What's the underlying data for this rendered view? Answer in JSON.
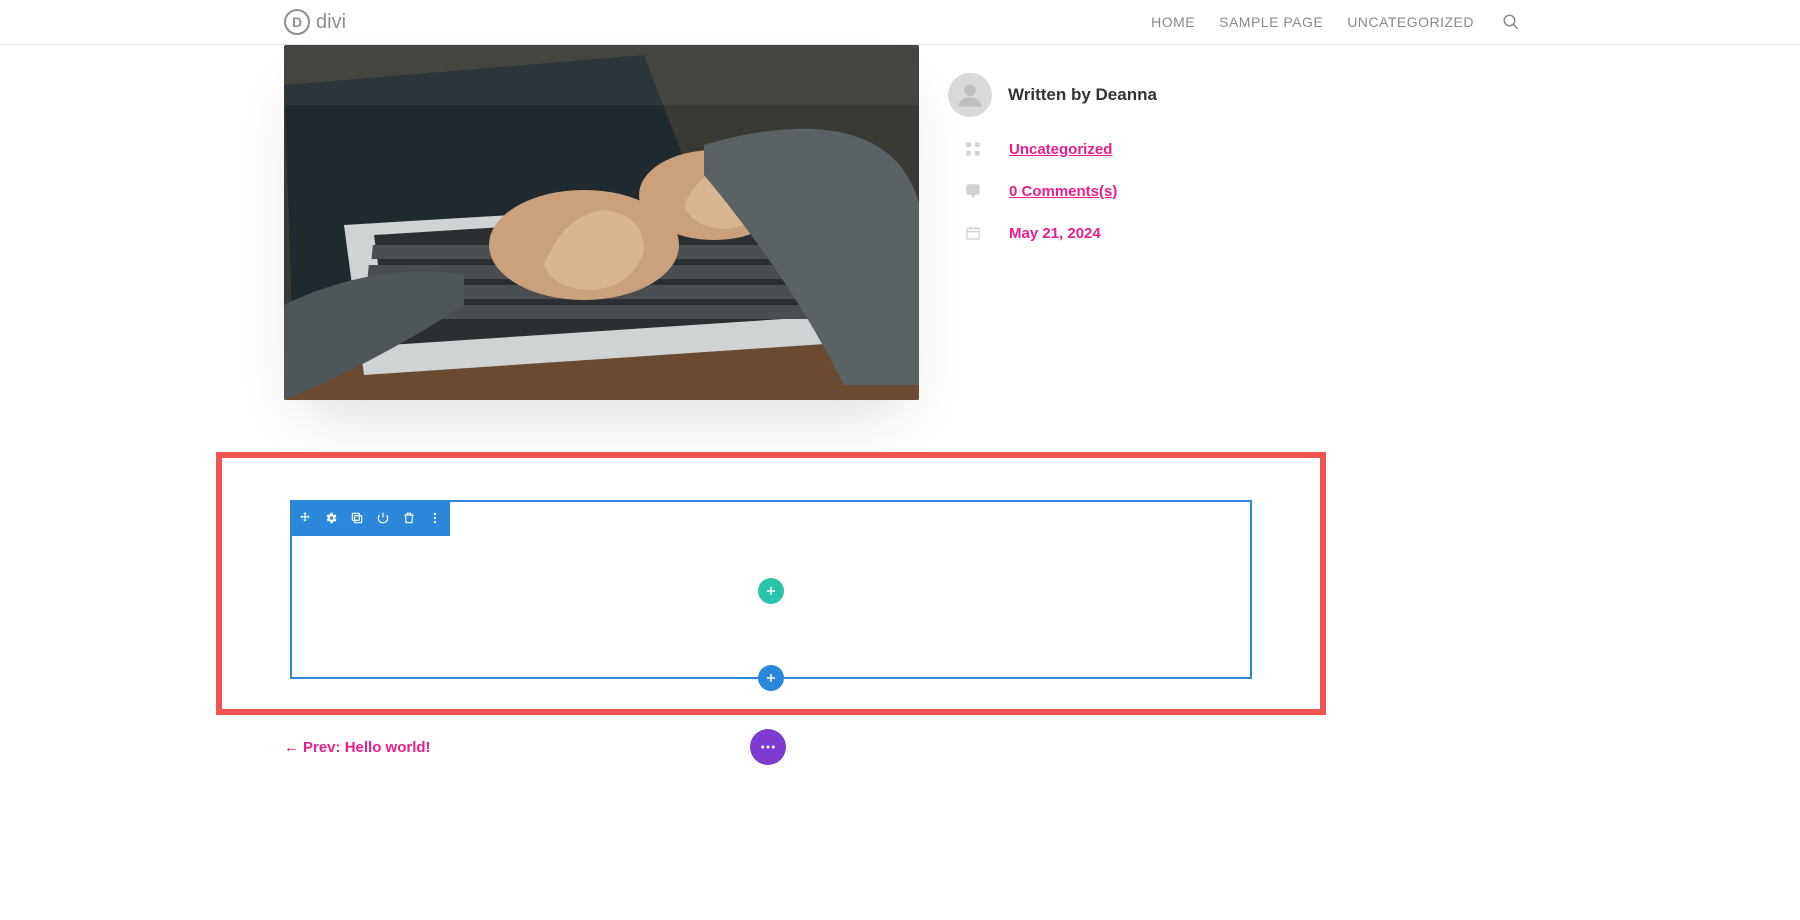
{
  "brand": "divi",
  "nav": {
    "items": [
      "HOME",
      "SAMPLE PAGE",
      "UNCATEGORIZED"
    ]
  },
  "author": {
    "prefix": "Written by ",
    "name": "Deanna"
  },
  "meta": {
    "category": "Uncategorized",
    "comments": "0 Comments(s)",
    "date": "May 21, 2024"
  },
  "prev": {
    "arrow": "←",
    "label": "Prev: Hello world!"
  },
  "colors": {
    "accent_pink": "#e91e8c",
    "row_blue": "#2b87da",
    "fab_green": "#29c4a9",
    "fab_purple": "#7e3bd0",
    "highlight_border": "#f0544f"
  },
  "icons": {
    "search": "search-icon",
    "category": "grid-icon",
    "comments": "comment-icon",
    "date": "calendar-icon",
    "toolbar": [
      "move-icon",
      "gear-icon",
      "duplicate-icon",
      "power-icon",
      "trash-icon",
      "more-vert-icon"
    ]
  }
}
